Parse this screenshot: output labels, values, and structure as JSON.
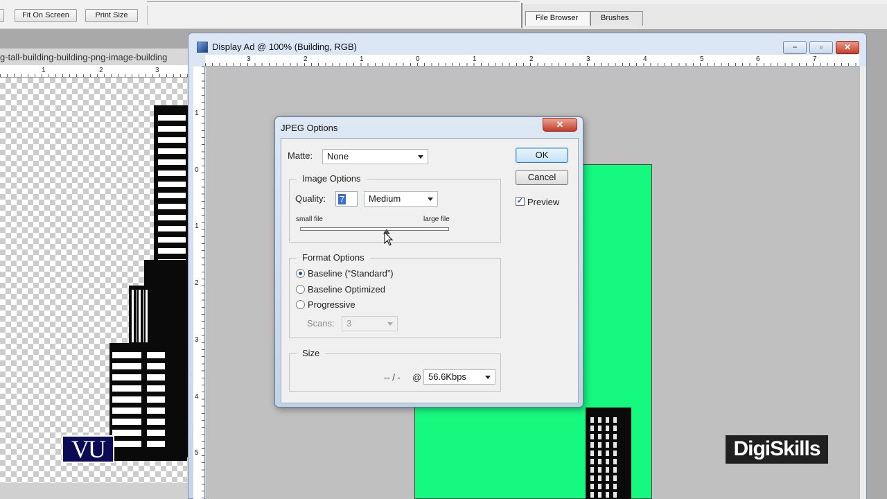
{
  "options_bar": {
    "fit_on_screen": "Fit On Screen",
    "print_size": "Print Size"
  },
  "palette_tabs": [
    "File Browser",
    "Brushes"
  ],
  "left_document": {
    "title": "g-tall-building-building-png-image-building",
    "ruler_numbers": [
      "1",
      "2",
      "3"
    ]
  },
  "document_window": {
    "title": "Display Ad @ 100% (Building, RGB)",
    "hruler_numbers": [
      "3",
      "2",
      "1",
      "0",
      "1",
      "2",
      "3",
      "4",
      "5",
      "6",
      "7"
    ],
    "vruler_numbers": [
      "1",
      "0",
      "1",
      "2",
      "3",
      "4",
      "5"
    ],
    "minimize": "−",
    "restore": "▫",
    "close": "✕"
  },
  "dialog": {
    "title": "JPEG Options",
    "close": "✕",
    "matte_label": "Matte:",
    "matte_value": "None",
    "ok": "OK",
    "cancel": "Cancel",
    "preview_label": "Preview",
    "preview_checked": true,
    "image_options": {
      "legend": "Image Options",
      "quality_label": "Quality:",
      "quality_value": "7",
      "quality_preset": "Medium",
      "small_file": "small file",
      "large_file": "large file",
      "slider_fraction": 0.58
    },
    "format_options": {
      "legend": "Format Options",
      "baseline_standard": "Baseline (“Standard”)",
      "baseline_optimized": "Baseline Optimized",
      "progressive": "Progressive",
      "scans_label": "Scans:",
      "scans_value": "3"
    },
    "size": {
      "legend": "Size",
      "estimate": "-- / -",
      "at": "@",
      "speed": "56.6Kbps"
    }
  },
  "logos": {
    "vu": "VU",
    "digiskills": "DigiSkills"
  },
  "colors": {
    "canvas_green": "#16f97f",
    "dialog_frame": "#c3d3e7",
    "close_red": "#c23b26"
  }
}
